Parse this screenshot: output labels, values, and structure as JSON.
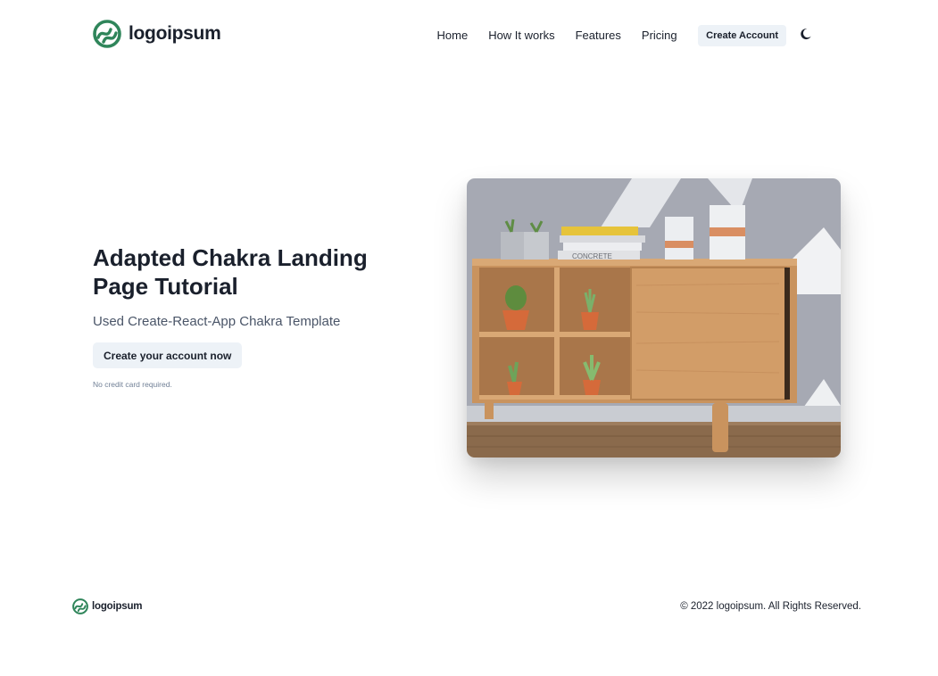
{
  "header": {
    "brand_name": "logoipsum",
    "brand_color": "#2f855a",
    "nav": [
      {
        "label": "Home"
      },
      {
        "label": "How It works"
      },
      {
        "label": "Features"
      },
      {
        "label": "Pricing"
      }
    ],
    "cta_label": "Create Account",
    "theme_toggle_icon": "moon-icon"
  },
  "hero": {
    "title": "Adapted Chakra Landing Page Tutorial",
    "subtitle": "Used Create-React-App Chakra Template",
    "button_label": "Create your account now",
    "note": "No credit card required.",
    "image_subject": "wooden sideboard with potted cacti, books and candles",
    "image_book_spine": "CONCRETE"
  },
  "footer": {
    "brand_name": "logoipsum",
    "copyright": "© 2022 logoipsum. All Rights Reserved."
  },
  "colors": {
    "text": "#1a202c",
    "muted": "#4a5568",
    "button_bg": "#edf2f7",
    "logo_green": "#2f855a"
  }
}
